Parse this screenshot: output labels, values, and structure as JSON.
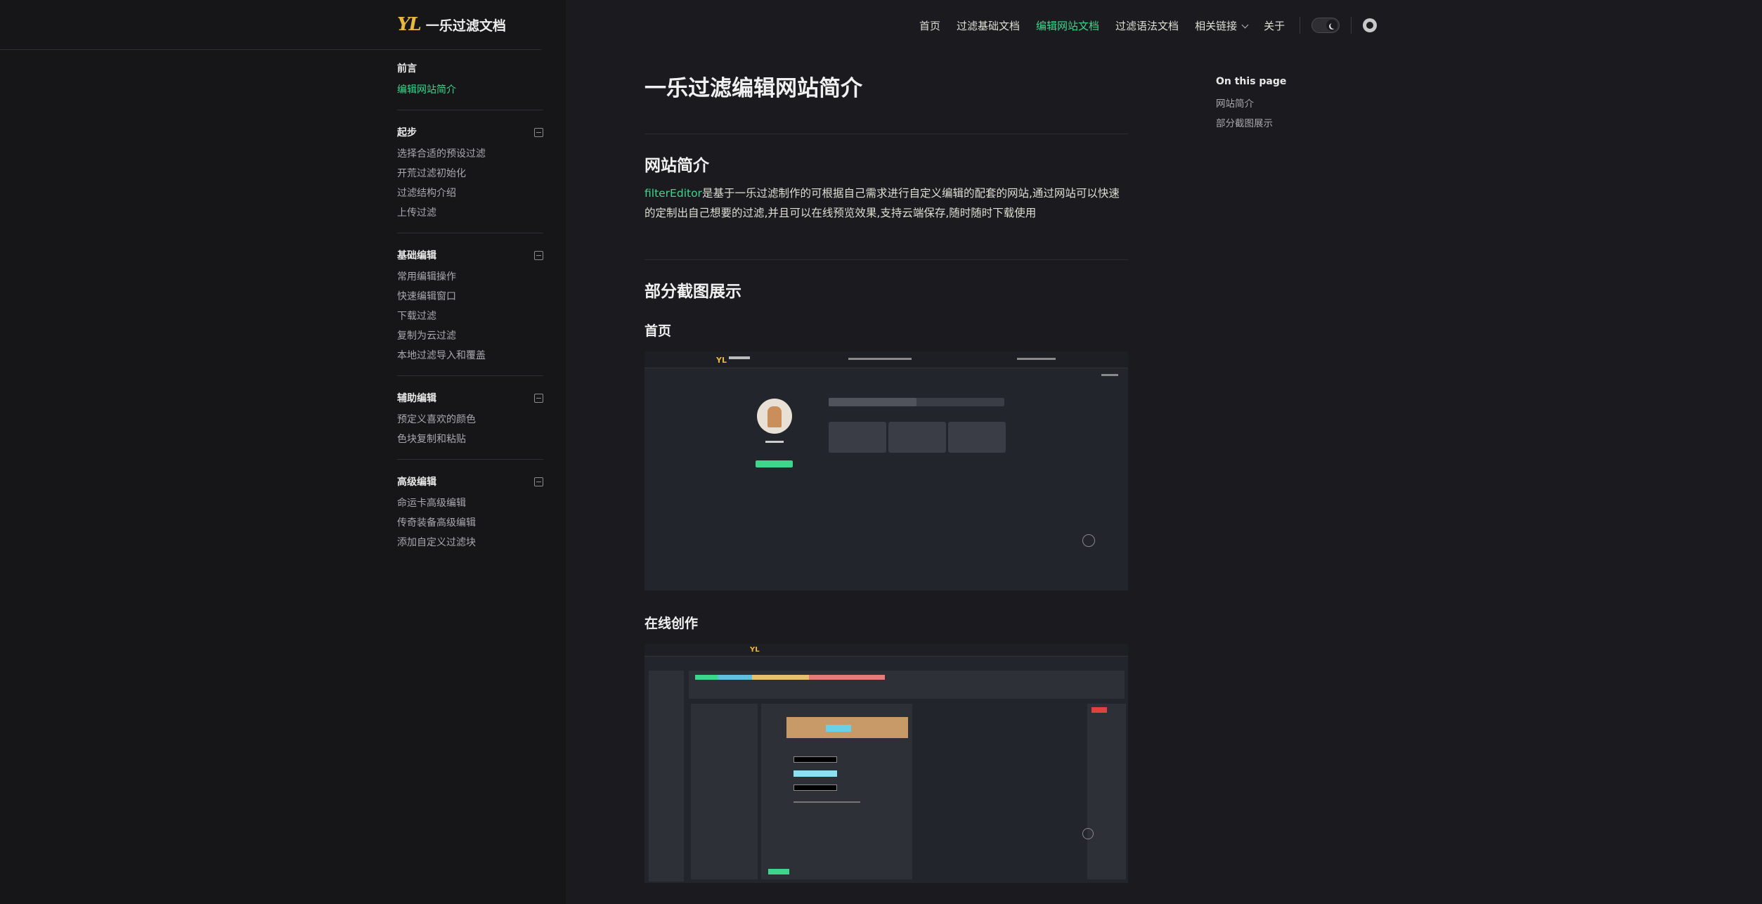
{
  "logo": {
    "mark": "YL",
    "text": "一乐过滤文档"
  },
  "nav": {
    "items": [
      "首页",
      "过滤基础文档",
      "编辑网站文档",
      "过滤语法文档",
      "相关链接",
      "关于"
    ],
    "active_index": 2
  },
  "sidebar": {
    "groups": [
      {
        "title": "前言",
        "collapsible": false,
        "items": [
          "编辑网站简介"
        ],
        "active_item": 0
      },
      {
        "title": "起步",
        "collapsible": true,
        "items": [
          "选择合适的预设过滤",
          "开荒过滤初始化",
          "过滤结构介绍",
          "上传过滤"
        ]
      },
      {
        "title": "基础编辑",
        "collapsible": true,
        "items": [
          "常用编辑操作",
          "快速编辑窗口",
          "下载过滤",
          "复制为云过滤",
          "本地过滤导入和覆盖"
        ]
      },
      {
        "title": "辅助编辑",
        "collapsible": true,
        "items": [
          "预定义喜欢的颜色",
          "色块复制和粘贴"
        ]
      },
      {
        "title": "高级编辑",
        "collapsible": true,
        "items": [
          "命运卡高级编辑",
          "传奇装备高级编辑",
          "添加自定义过滤块"
        ]
      }
    ]
  },
  "content": {
    "title": "一乐过滤编辑网站简介",
    "section1": {
      "heading": "网站简介",
      "highlight": "filterEditor",
      "text": "是基于一乐过滤制作的可根据自己需求进行自定义编辑的配套的网站,通过网站可以快速的定制出自己想要的过滤,并且可以在线预览效果,支持云端保存,随时随时下载使用"
    },
    "section2": {
      "heading": "部分截图展示",
      "sub1": "首页",
      "sub2": "在线创作"
    }
  },
  "outline": {
    "title": "On this page",
    "items": [
      "网站简介",
      "部分截图展示"
    ]
  },
  "colors": {
    "accent": "#3dd68c",
    "logo": "#e8b93e",
    "bg": "#1b1b1f",
    "sidebar_bg": "#161618"
  },
  "icons": [
    "chevron-down-icon",
    "moon-icon",
    "github-icon",
    "collapse-icon"
  ]
}
